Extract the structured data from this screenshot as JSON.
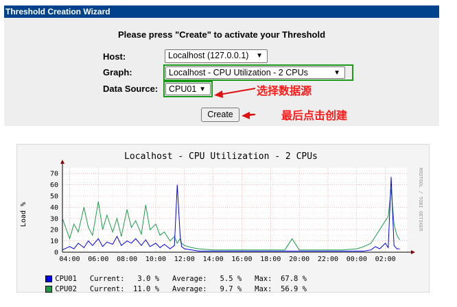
{
  "wizard": {
    "title": "Threshold Creation Wizard",
    "instruction": "Please press \"Create\" to activate your Threshold",
    "host_label": "Host:",
    "host_value": "Localhost (127.0.0.1)",
    "graph_label": "Graph:",
    "graph_value": "Localhost - CPU Utilization - 2 CPUs",
    "ds_label": "Data Source:",
    "ds_value": "CPU01",
    "create_label": "Create",
    "annotation_ds": "选择数据源",
    "annotation_create": "最后点击创建"
  },
  "graph": {
    "vertical_label": "Load %",
    "side_text": "RRDTOOL / TOBI OETIKER",
    "legend": [
      {
        "color": "#0000ee",
        "name": "CPU01",
        "current": "3.0 %",
        "average": "5.5 %",
        "max": "67.8 %"
      },
      {
        "color": "#1a9a4a",
        "name": "CPU02",
        "current": "11.0 %",
        "average": "9.7 %",
        "max": "56.9 %"
      }
    ]
  },
  "chart_data": {
    "type": "line",
    "title": "Localhost - CPU Utilization - 2 CPUs",
    "ylabel": "Load %",
    "xlabel": "",
    "ylim": [
      0,
      75
    ],
    "y_ticks": [
      0,
      10,
      20,
      30,
      40,
      50,
      60,
      70
    ],
    "x_ticks": [
      "04:00",
      "06:00",
      "08:00",
      "10:00",
      "12:00",
      "14:00",
      "16:00",
      "18:00",
      "20:00",
      "22:00",
      "00:00",
      "02:00"
    ],
    "grid": true,
    "series": [
      {
        "name": "CPU01",
        "color": "#0000ee",
        "x": [
          3.5,
          4,
          4.3,
          4.6,
          5,
          5.3,
          5.6,
          6,
          6.3,
          6.6,
          7,
          7.3,
          7.6,
          8,
          8.3,
          8.6,
          9,
          9.3,
          9.6,
          10,
          10.3,
          10.6,
          11,
          11.3,
          11.5,
          11.7,
          11.8,
          12,
          12.5,
          13,
          14,
          15,
          16,
          17,
          18,
          19,
          20,
          21,
          22,
          23,
          0,
          0.5,
          1,
          1.3,
          1.6,
          2,
          2.2,
          2.4,
          2.6,
          2.8,
          3
        ],
        "y": [
          2,
          5,
          3,
          8,
          4,
          10,
          6,
          12,
          5,
          9,
          7,
          14,
          6,
          10,
          8,
          12,
          6,
          11,
          5,
          8,
          4,
          7,
          3,
          6,
          60,
          15,
          5,
          3,
          2,
          1,
          1,
          1,
          1,
          1,
          1,
          1,
          1,
          1,
          1,
          1,
          1,
          1,
          2,
          5,
          3,
          8,
          4,
          67,
          6,
          3,
          3
        ]
      },
      {
        "name": "CPU02",
        "color": "#1a9a4a",
        "x": [
          3.5,
          4,
          4.3,
          4.6,
          5,
          5.3,
          5.6,
          6,
          6.3,
          6.6,
          7,
          7.3,
          7.6,
          8,
          8.3,
          8.6,
          9,
          9.3,
          9.6,
          10,
          10.3,
          10.6,
          11,
          11.3,
          11.5,
          11.7,
          11.8,
          12,
          12.5,
          13,
          14,
          15,
          16,
          17,
          18,
          19,
          19.5,
          20,
          21,
          22,
          23,
          0,
          0.5,
          1,
          1.3,
          1.6,
          2,
          2.2,
          2.4,
          2.6,
          2.8,
          3
        ],
        "y": [
          30,
          12,
          25,
          18,
          40,
          22,
          15,
          45,
          20,
          33,
          18,
          30,
          14,
          38,
          22,
          28,
          16,
          42,
          20,
          25,
          15,
          18,
          10,
          14,
          8,
          12,
          8,
          6,
          4,
          3,
          2,
          2,
          2,
          2,
          2,
          2,
          12,
          2,
          2,
          2,
          2,
          3,
          5,
          8,
          14,
          20,
          28,
          32,
          56,
          25,
          15,
          11
        ]
      }
    ]
  }
}
